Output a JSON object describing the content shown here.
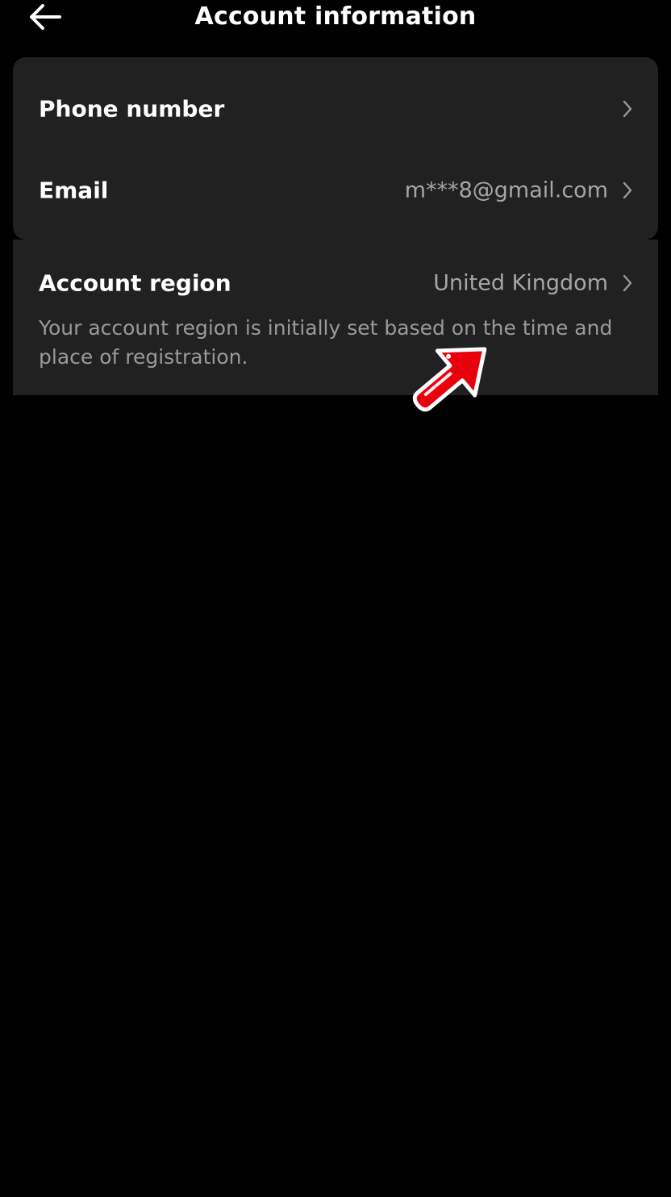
{
  "header": {
    "title": "Account information",
    "back_icon": "arrow-left-icon"
  },
  "account_rows": [
    {
      "label": "Phone number",
      "value": "",
      "icon": "chevron-right-icon"
    },
    {
      "label": "Email",
      "value": "m***8@gmail.com",
      "icon": "chevron-right-icon"
    }
  ],
  "region": {
    "label": "Account region",
    "value": "United Kingdom",
    "icon": "chevron-right-icon",
    "description": "Your account region is initially set based on the time and place of registration."
  },
  "colors": {
    "background": "#000000",
    "card": "#212121",
    "primary_text": "#ffffff",
    "secondary_text": "#a6a6a6",
    "annotation_arrow": "#e8000d"
  },
  "overlay": {
    "annotation_icon": "red-pointer-arrow-icon"
  }
}
